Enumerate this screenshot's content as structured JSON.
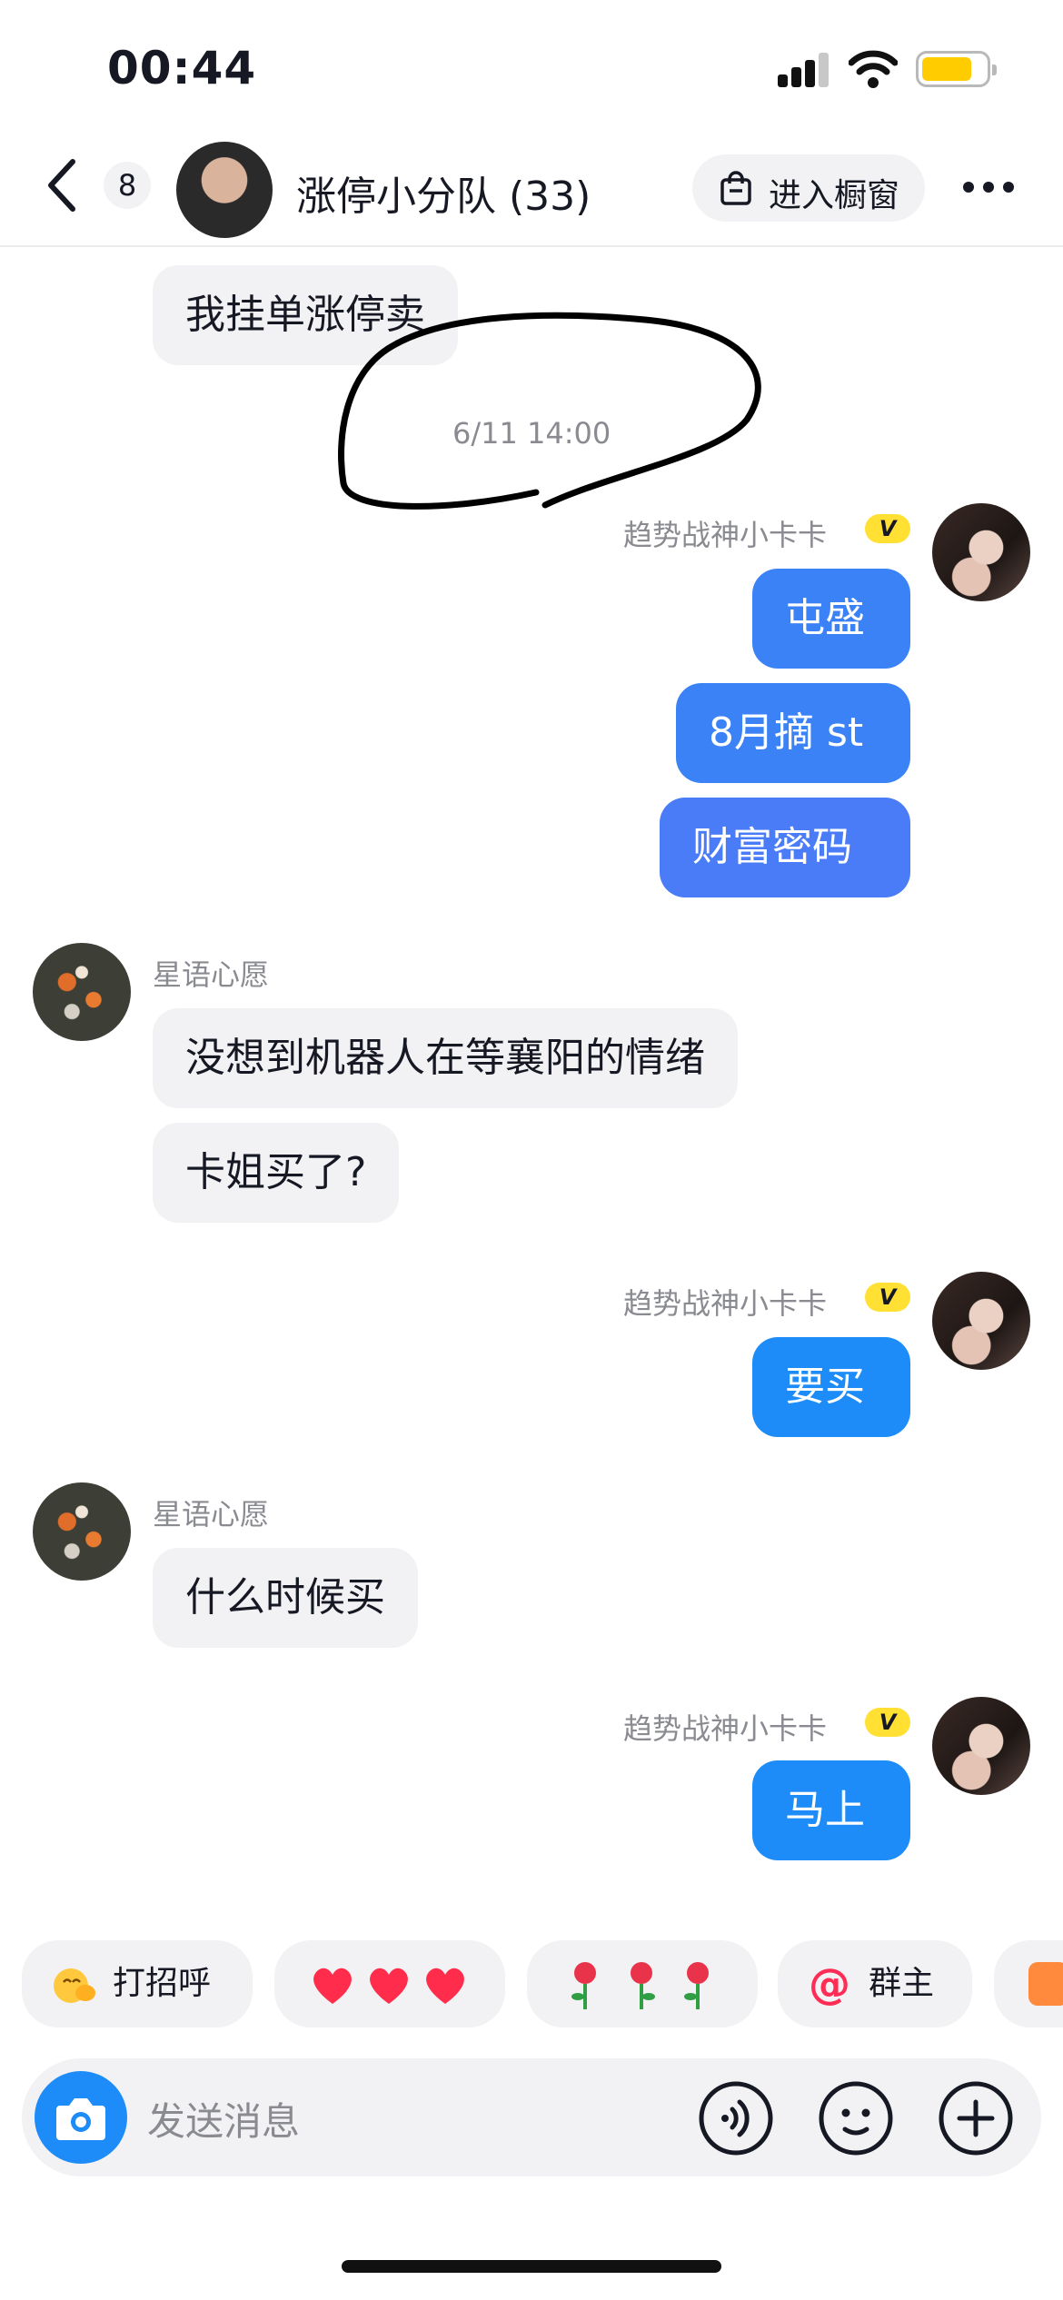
{
  "status_bar": {
    "time": "00:44"
  },
  "header": {
    "back_label": "back",
    "unread_count": "8",
    "title": "涨停小分队 (33)",
    "shop_button": "进入橱窗"
  },
  "messages": {
    "m1": {
      "text": "我挂单涨停卖"
    },
    "timestamp": "6/11 14:00",
    "g1": {
      "sender": "趋势战神小卡卡",
      "badge": "V",
      "lines": [
        "屯盛",
        "8月摘 st",
        "财富密码"
      ]
    },
    "g2": {
      "sender": "星语心愿",
      "lines": [
        "没想到机器人在等襄阳的情绪",
        "卡姐买了?"
      ]
    },
    "g3": {
      "sender": "趋势战神小卡卡",
      "badge": "V",
      "lines": [
        "要买"
      ]
    },
    "g4": {
      "sender": "星语心愿",
      "lines": [
        "什么时候买"
      ]
    },
    "g5": {
      "sender": "趋势战神小卡卡",
      "badge": "V",
      "lines": [
        "马上"
      ]
    }
  },
  "quick_replies": {
    "greet": "打招呼",
    "hearts": "",
    "roses": "",
    "at_owner": "群主"
  },
  "composer": {
    "placeholder": "发送消息"
  },
  "colors": {
    "accent": "#1d8cf8",
    "bubble_right": "#3b82f6",
    "bubble_left": "#f2f2f4",
    "badge": "#ffe033"
  }
}
